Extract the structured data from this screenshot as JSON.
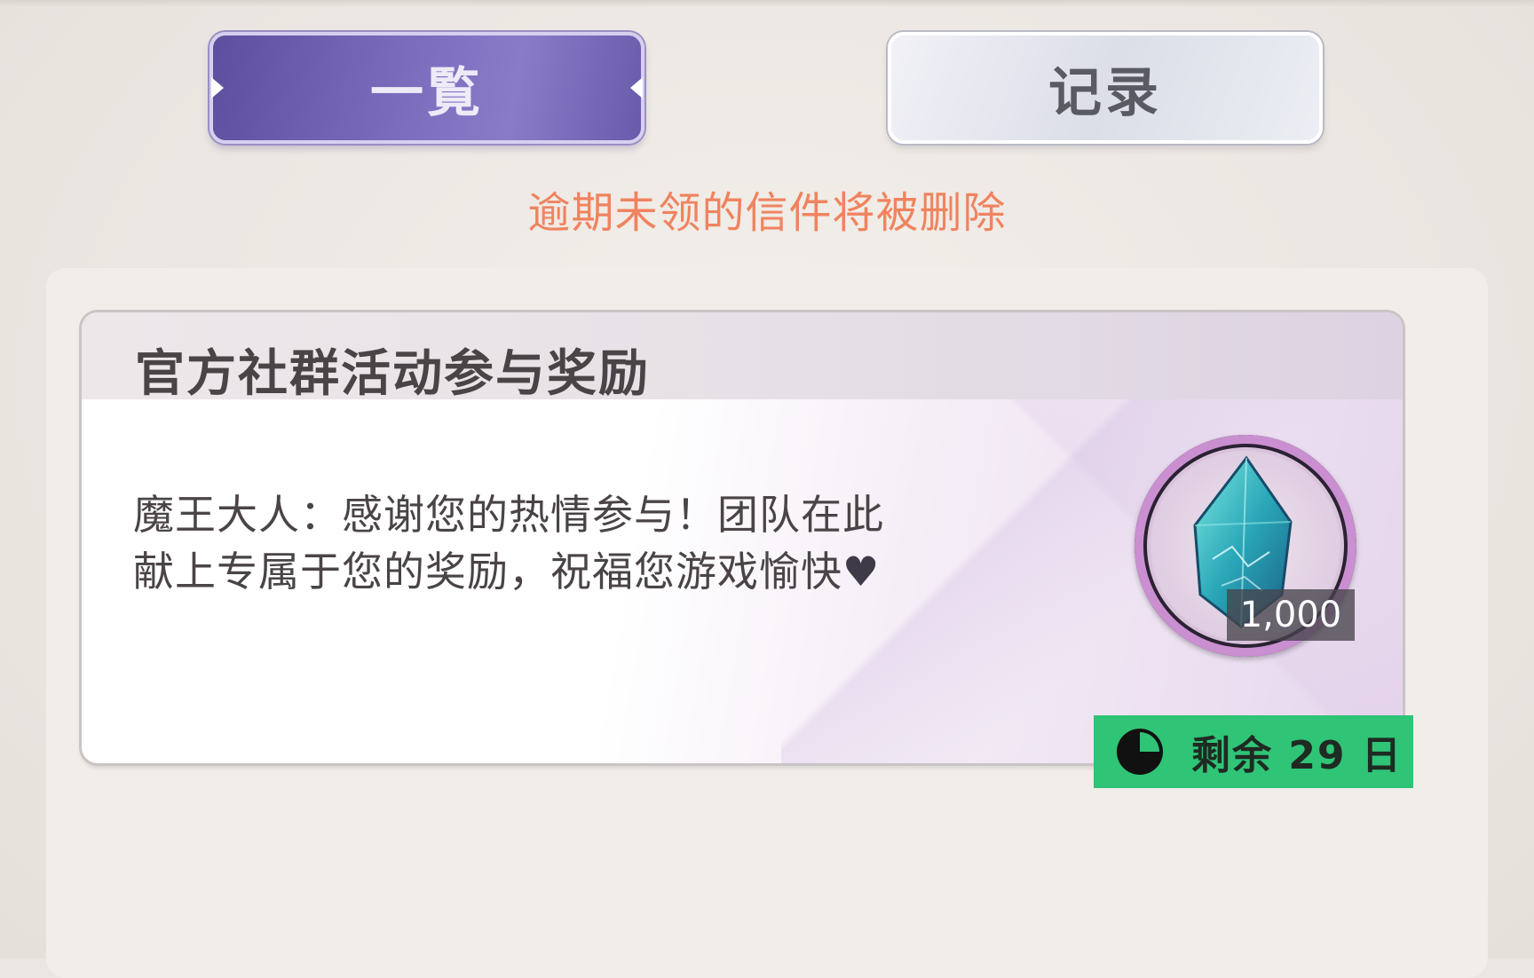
{
  "tabs": [
    {
      "label": "一覧",
      "active": true
    },
    {
      "label": "记录",
      "active": false
    }
  ],
  "notice": "逾期未领的信件将被删除",
  "mail": {
    "title": "官方社群活动参与奖励",
    "body_line1": "魔王大人：感谢您的热情参与！团队在此",
    "body_line2": "献上专属于您的奖励，祝福您游戏愉快",
    "body_heart": "♥",
    "reward": {
      "icon": "blue-crystal-gem-icon",
      "count": "1,000"
    },
    "expire": {
      "icon": "clock-icon",
      "text": "剩余 29 日"
    }
  },
  "colors": {
    "active_tab": "#7567b8",
    "notice": "#f0835f",
    "expire_badge": "#2fc476",
    "background": "#ebe6e1"
  }
}
